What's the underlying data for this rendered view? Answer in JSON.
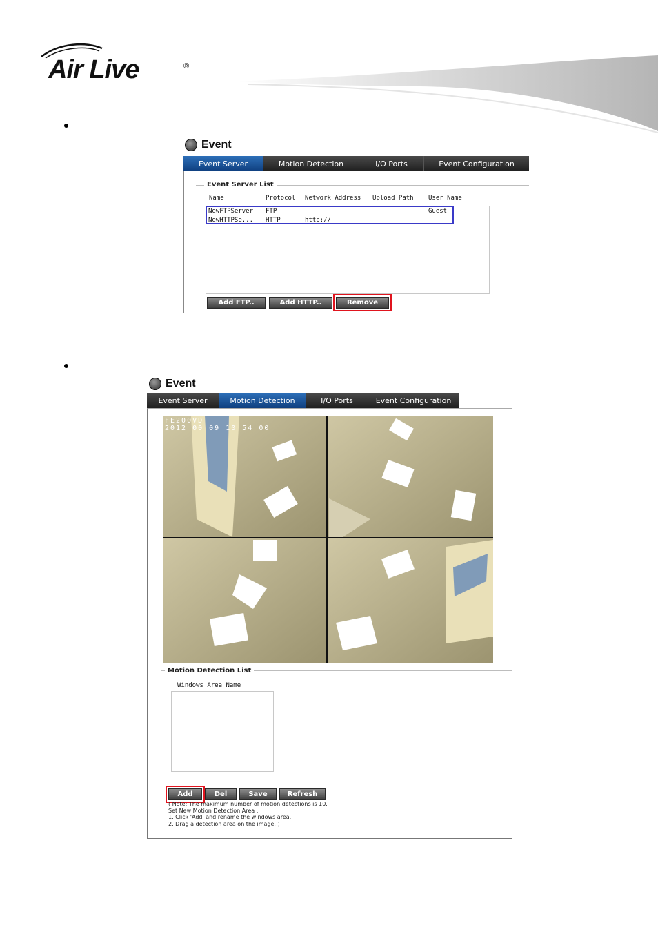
{
  "header": {
    "brand": "Air Live",
    "registered": "®"
  },
  "event_server_panel": {
    "title": "Event",
    "tabs": [
      "Event Server",
      "Motion Detection",
      "I/O Ports",
      "Event Configuration"
    ],
    "active_tab": "Event Server",
    "list_title": "Event Server List",
    "columns": [
      "Name",
      "Protocol",
      "Network Address",
      "Upload Path",
      "User Name"
    ],
    "rows": [
      {
        "name": "NewFTPServer",
        "protocol": "FTP",
        "address": "",
        "path": "",
        "user": "Guest"
      },
      {
        "name": "NewHTTPSe...",
        "protocol": "HTTP",
        "address": "http://",
        "path": "",
        "user": ""
      }
    ],
    "buttons": {
      "add_ftp": "Add FTP..",
      "add_http": "Add HTTP..",
      "remove": "Remove"
    }
  },
  "motion_panel": {
    "title": "Event",
    "tabs": [
      "Event Server",
      "Motion Detection",
      "I/O Ports",
      "Event Configuration"
    ],
    "active_tab": "Motion Detection",
    "camera_overlay_line1": "FE200VD",
    "camera_overlay_line2": "2012 00 09 10 54 00",
    "list_title": "Motion Detection List",
    "column": "Windows Area Name",
    "buttons": {
      "add": "Add",
      "del": "Del",
      "save": "Save",
      "refresh": "Refresh"
    },
    "note": "( Note: The maximum number of motion detections is 10.\nSet New Motion Detection Area :\n1. Click 'Add' and rename the windows area.\n2. Drag a detection area on the image. )"
  },
  "colors": {
    "highlight_red": "#e0141e",
    "highlight_blue": "#3a3ac8",
    "tab_active": "#1f5aa0",
    "tab_bar": "#2e2e2e"
  }
}
